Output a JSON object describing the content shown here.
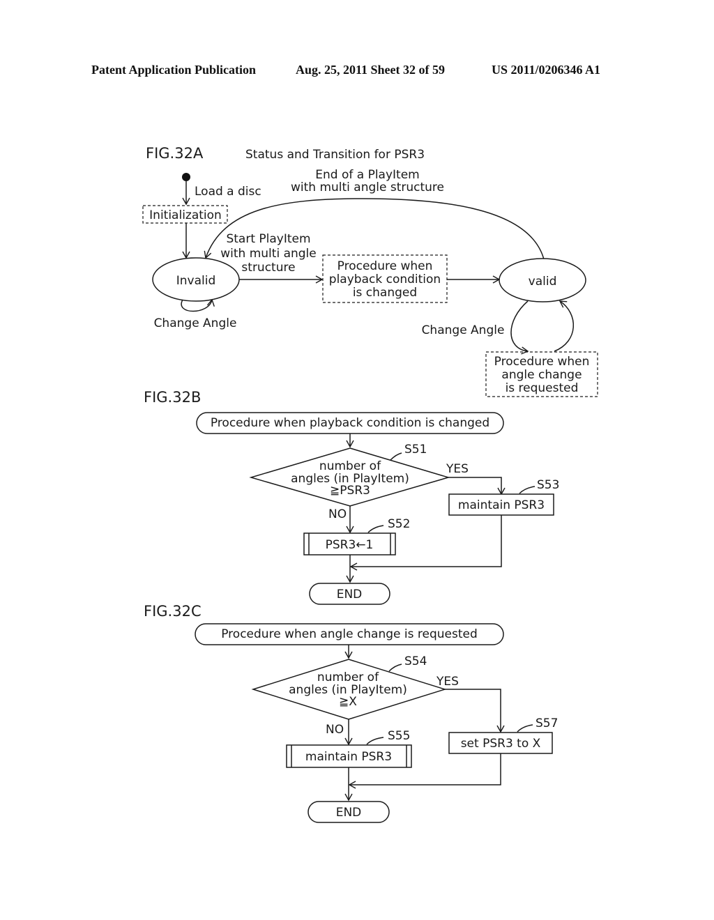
{
  "header": {
    "left": "Patent Application Publication",
    "date_sheet": "Aug. 25, 2011  Sheet 32 of 59",
    "pub_number": "US 2011/0206346 A1"
  },
  "fig32a": {
    "fig_label": "FIG.32A",
    "title": "Status and Transition for PSR3",
    "load_disc": "Load a disc",
    "initialization": "Initialization",
    "end_playitem": [
      "End of a PlayItem",
      "with multi angle structure"
    ],
    "start_playitem": [
      "Start PlayItem",
      "with multi angle",
      "structure"
    ],
    "invalid": "Invalid",
    "valid": "valid",
    "change_angle_left": "Change Angle",
    "change_angle_right": "Change Angle",
    "proc_playback": [
      "Procedure when",
      "playback condition",
      "is changed"
    ],
    "proc_angle": [
      "Procedure when",
      "angle change",
      "is requested"
    ]
  },
  "fig32b": {
    "fig_label": "FIG.32B",
    "start": "Procedure when playback condition is changed",
    "decision": [
      "number of",
      "angles (in PlayItem)",
      "≧PSR3"
    ],
    "step_decision": "S51",
    "yes": "YES",
    "no": "NO",
    "yes_box": "maintain PSR3",
    "step_yes": "S53",
    "no_box": "PSR3←1",
    "step_no": "S52",
    "end": "END"
  },
  "fig32c": {
    "fig_label": "FIG.32C",
    "start": "Procedure when angle change is requested",
    "decision": [
      "number of",
      "angles (in PlayItem)",
      "≧X"
    ],
    "step_decision": "S54",
    "yes": "YES",
    "no": "NO",
    "yes_box": "set PSR3 to X",
    "step_yes": "S57",
    "no_box": "maintain PSR3",
    "step_no": "S55",
    "end": "END"
  }
}
